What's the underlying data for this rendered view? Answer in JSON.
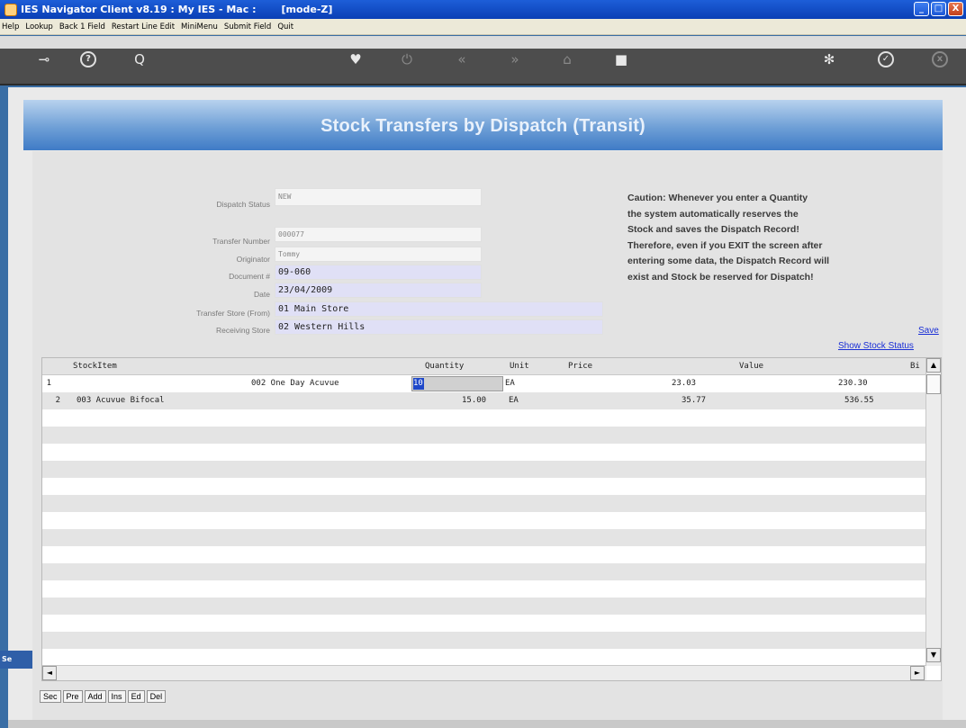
{
  "window": {
    "title": "IES Navigator Client v8.19 : My IES - Mac :",
    "mode": "[mode-Z]",
    "minimize": "_",
    "maximize": "□",
    "close": "X"
  },
  "menu": [
    "Help",
    "Lookup",
    "Back 1 Field",
    "Restart Line Edit",
    "MiniMenu",
    "Submit Field",
    "Quit"
  ],
  "toolbar": {
    "icons": [
      "key-icon",
      "help-icon",
      "search-icon",
      "heart-icon",
      "power-icon",
      "rewind-icon",
      "forward-icon",
      "tree-icon",
      "stop-icon",
      "gear-icon",
      "check-icon",
      "close-icon"
    ],
    "glyphs": {
      "key": "⊸",
      "help": "?",
      "search": "Q",
      "heart": "♥",
      "power": "⏻",
      "rewind": "«",
      "forward": "»",
      "tree": "⌂",
      "stop": "■",
      "gear": "✻",
      "check": "✓",
      "close": "x"
    }
  },
  "banner": {
    "title": "Stock Transfers by Dispatch (Transit)"
  },
  "form": {
    "dispatch_status": {
      "label": "Dispatch Status",
      "value": "NEW"
    },
    "transfer_number": {
      "label": "Transfer Number",
      "value": "000077"
    },
    "originator": {
      "label": "Originator",
      "value": "Tommy"
    },
    "document": {
      "label": "Document #",
      "value": "09-060"
    },
    "date": {
      "label": "Date",
      "value": "23/04/2009"
    },
    "transfer_store": {
      "label": "Transfer Store (From)",
      "value": "01 Main Store"
    },
    "receiving_store": {
      "label": "Receiving Store",
      "value": "02 Western Hills"
    }
  },
  "caution": {
    "lines": [
      "Caution: Whenever you enter a Quantity",
      "the system automatically reserves the",
      "Stock and saves the Dispatch Record!",
      "Therefore, even if you EXIT the screen after",
      "entering some data, the Dispatch Record will",
      "exist and Stock be reserved for Dispatch!"
    ]
  },
  "links": {
    "save": "Save",
    "show_stock_status": "Show Stock Status"
  },
  "grid": {
    "headers": {
      "stock_item": "StockItem",
      "quantity": "Quantity",
      "unit": "Unit",
      "price": "Price",
      "value": "Value",
      "bin": "Bi"
    },
    "rows": [
      {
        "num": "1",
        "item": "002 One Day Acuvue",
        "qty": "10",
        "unit": "EA",
        "price": "23.03",
        "value": "230.30"
      },
      {
        "num": "2",
        "item": "003 Acuvue Bifocal",
        "qty": "15.00",
        "unit": "EA",
        "price": "35.77",
        "value": "536.55"
      }
    ]
  },
  "scroll": {
    "up": "▲",
    "down": "▼",
    "left": "◄",
    "right": "►"
  },
  "actions": [
    "Sec",
    "Pre",
    "Add",
    "Ins",
    "Ed",
    "Del"
  ],
  "side_stub": "Se"
}
